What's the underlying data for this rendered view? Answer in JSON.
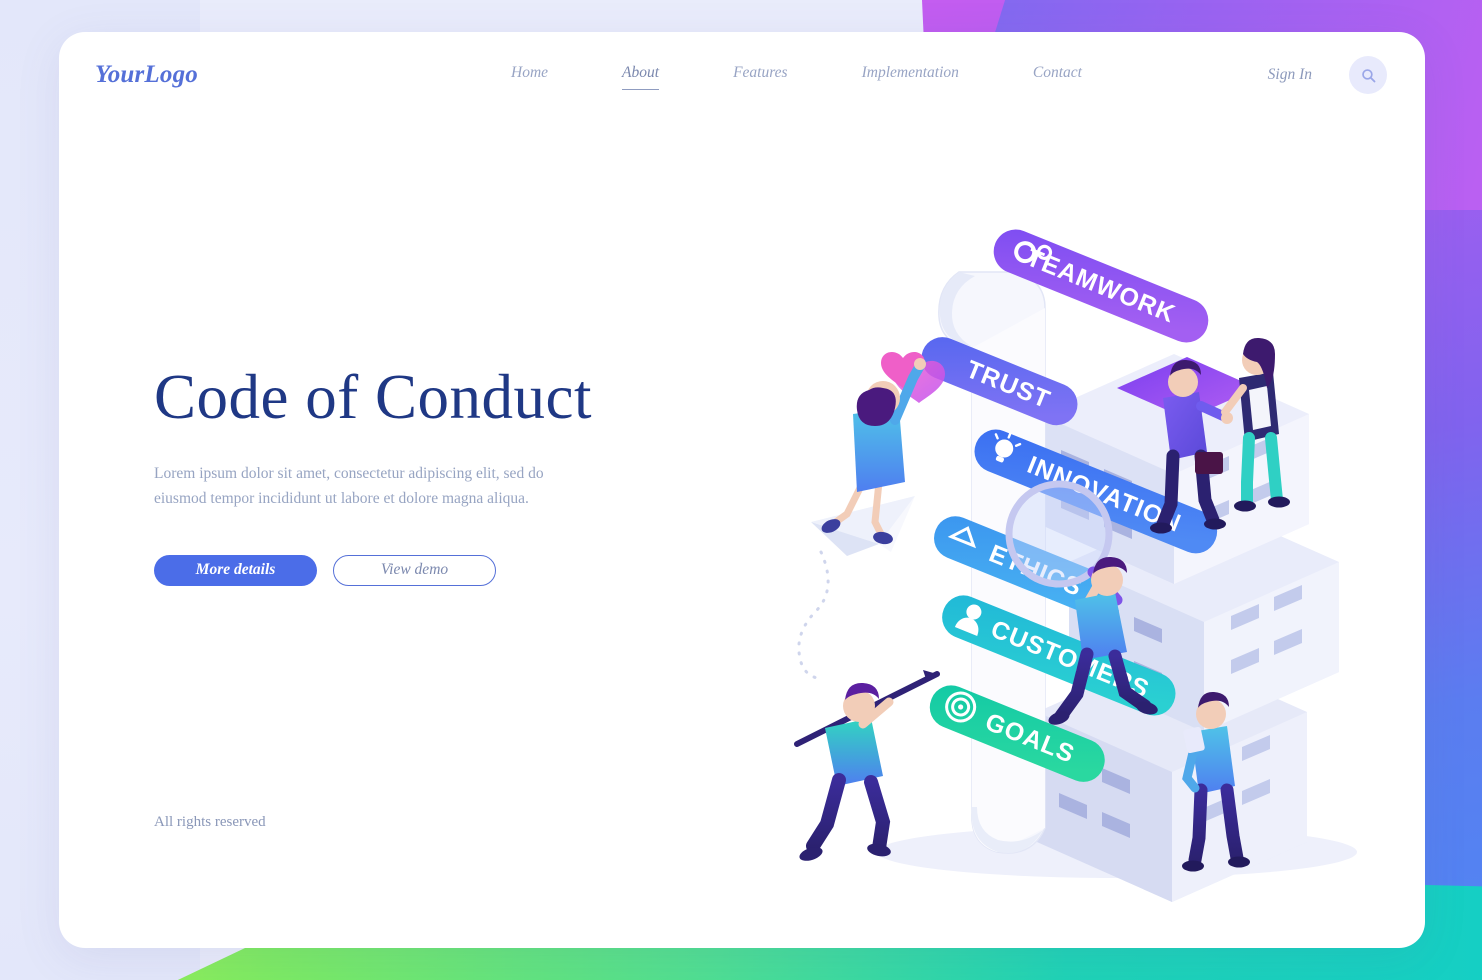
{
  "header": {
    "logo": "YourLogo",
    "nav": [
      {
        "label": "Home",
        "active": false
      },
      {
        "label": "About",
        "active": true
      },
      {
        "label": "Features",
        "active": false
      },
      {
        "label": "Implementation",
        "active": false
      },
      {
        "label": "Contact",
        "active": false
      }
    ],
    "sign_in": "Sign In",
    "search_icon": "search-icon"
  },
  "hero": {
    "title": "Code of Conduct",
    "paragraph": "Lorem ipsum dolor sit amet, consectetur adipiscing elit, sed do eiusmod tempor incididunt ut labore et dolore magna aliqua.",
    "primary_button": "More details",
    "secondary_button": "View demo"
  },
  "footer": {
    "rights": "All rights reserved"
  },
  "illustration": {
    "name": "isometric-code-of-conduct-scroll",
    "banners": [
      {
        "label": "TEAMWORK",
        "icon": "gears-icon",
        "color": "#8a5df0"
      },
      {
        "label": "TRUST",
        "icon": "heart-icon",
        "color": "#5a6ff0"
      },
      {
        "label": "INNOVATION",
        "icon": "lightbulb-icon",
        "color": "#3f74f2"
      },
      {
        "label": "ETHICS",
        "icon": "scales-icon",
        "color": "#3d9bf0"
      },
      {
        "label": "CUSTOMERS",
        "icon": "person-icon",
        "color": "#29c0d8"
      },
      {
        "label": "GOALS",
        "icon": "target-icon",
        "color": "#16cba6"
      }
    ],
    "characters": [
      "woman-on-paper-plane-holding-heart",
      "man-with-magnifying-glass",
      "man-carrying-arrow",
      "businessman-handshake",
      "businesswoman-handshake",
      "man-with-tablet"
    ]
  },
  "colors": {
    "brand": "#5570d8",
    "title": "#1f3885",
    "muted": "#97a4c2",
    "primary_button": "#4b6de8",
    "accent_purple": "#8a5df0",
    "accent_teal": "#16cba6"
  }
}
